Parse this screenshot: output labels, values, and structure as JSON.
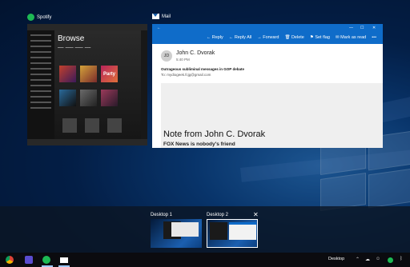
{
  "windows": {
    "spotify": {
      "title": "Spotify",
      "browse": "Browse",
      "tiles": [
        "Party"
      ]
    },
    "mail": {
      "title": "Mail",
      "actions": [
        "← Reply",
        "← Reply All",
        "→ Forward",
        "🗑 Delete",
        "⚑ Set flag",
        "✉ Mark as read",
        "•••"
      ],
      "avatar_initials": "JD",
      "sender": "John C. Dvorak",
      "time": "5:40 PM",
      "subject": "Outrageous subliminal messages in GOP debate",
      "to": "To: mydiogeek.fcjg@gmail.com",
      "note_title": "Note from John C. Dvorak",
      "note_sub": "FOX News is nobody's friend"
    }
  },
  "desktops": [
    {
      "label": "Desktop 1"
    },
    {
      "label": "Desktop 2"
    }
  ],
  "taskbar": {
    "desktop_button": "Desktop",
    "tray_icons": [
      "chevron-up-icon",
      "cloud-icon",
      "people-icon",
      "spotify-icon",
      "bluetooth-icon"
    ]
  },
  "colors": {
    "mail_accent": "#0f6cc9",
    "spotify_green": "#1db954"
  }
}
